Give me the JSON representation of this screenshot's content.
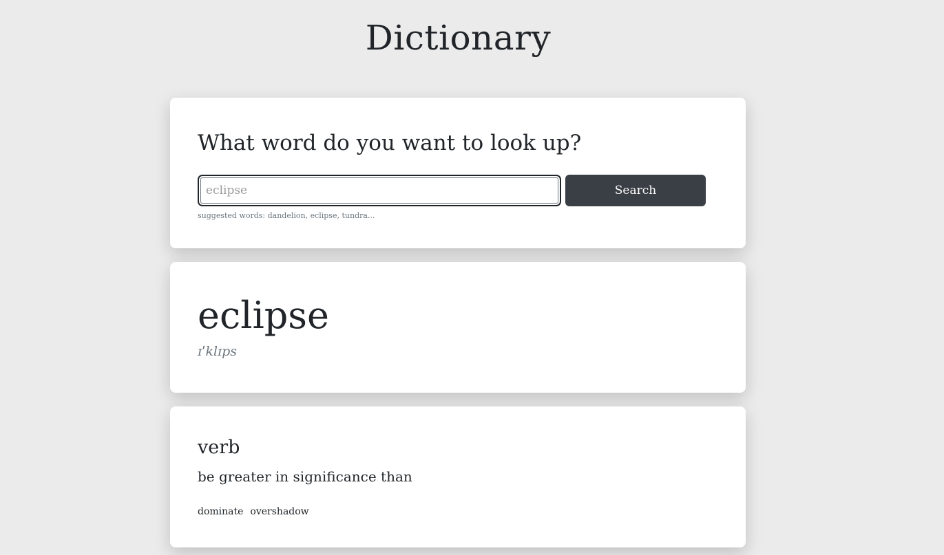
{
  "header": {
    "title": "Dictionary"
  },
  "search": {
    "heading": "What word do you want to look up?",
    "placeholder": "eclipse",
    "value": "",
    "button_label": "Search",
    "suggestions_text": "suggested words: dandelion, eclipse, tundra..."
  },
  "result": {
    "word": "eclipse",
    "phonetic": "ɪˈklɪps"
  },
  "meaning": {
    "part_of_speech": "verb",
    "definition": "be greater in significance than",
    "synonyms": [
      "dominate",
      "overshadow"
    ]
  },
  "colors": {
    "background": "#ebebeb",
    "card": "#ffffff",
    "button": "#3a3e45",
    "text": "#212529",
    "muted": "#6c757d"
  }
}
